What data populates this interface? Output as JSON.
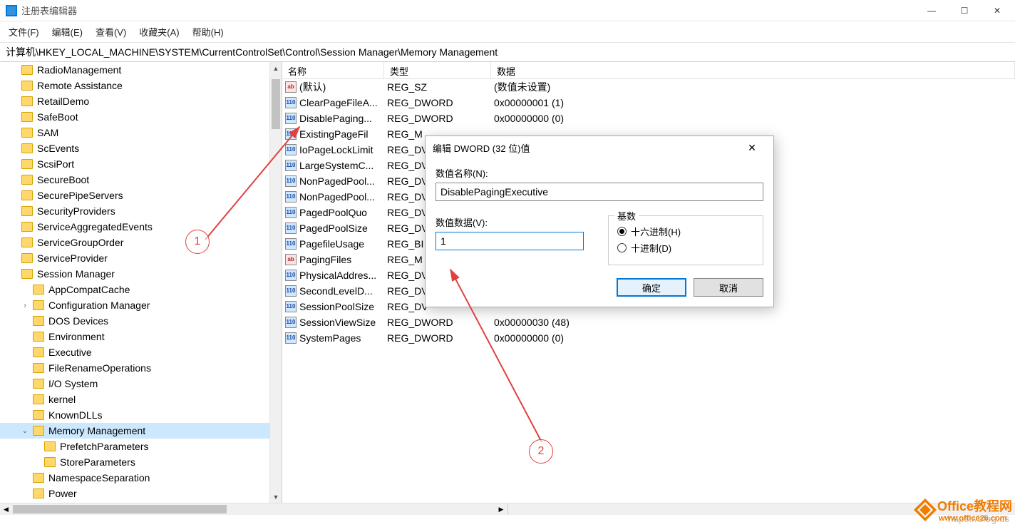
{
  "window": {
    "title": "注册表编辑器"
  },
  "menu": [
    "文件(F)",
    "编辑(E)",
    "查看(V)",
    "收藏夹(A)",
    "帮助(H)"
  ],
  "address": "计算机\\HKEY_LOCAL_MACHINE\\SYSTEM\\CurrentControlSet\\Control\\Session Manager\\Memory Management",
  "tree": [
    {
      "label": "RadioManagement",
      "indent": 0
    },
    {
      "label": "Remote Assistance",
      "indent": 0
    },
    {
      "label": "RetailDemo",
      "indent": 0
    },
    {
      "label": "SafeBoot",
      "indent": 0
    },
    {
      "label": "SAM",
      "indent": 0
    },
    {
      "label": "ScEvents",
      "indent": 0
    },
    {
      "label": "ScsiPort",
      "indent": 0
    },
    {
      "label": "SecureBoot",
      "indent": 0
    },
    {
      "label": "SecurePipeServers",
      "indent": 0
    },
    {
      "label": "SecurityProviders",
      "indent": 0
    },
    {
      "label": "ServiceAggregatedEvents",
      "indent": 0
    },
    {
      "label": "ServiceGroupOrder",
      "indent": 0
    },
    {
      "label": "ServiceProvider",
      "indent": 0
    },
    {
      "label": "Session Manager",
      "indent": 0
    },
    {
      "label": "AppCompatCache",
      "indent": 1
    },
    {
      "label": "Configuration Manager",
      "indent": 1,
      "expander": ">"
    },
    {
      "label": "DOS Devices",
      "indent": 1
    },
    {
      "label": "Environment",
      "indent": 1
    },
    {
      "label": "Executive",
      "indent": 1
    },
    {
      "label": "FileRenameOperations",
      "indent": 1
    },
    {
      "label": "I/O System",
      "indent": 1
    },
    {
      "label": "kernel",
      "indent": 1
    },
    {
      "label": "KnownDLLs",
      "indent": 1
    },
    {
      "label": "Memory Management",
      "indent": 1,
      "expander": "v",
      "selected": true
    },
    {
      "label": "PrefetchParameters",
      "indent": 2
    },
    {
      "label": "StoreParameters",
      "indent": 2
    },
    {
      "label": "NamespaceSeparation",
      "indent": 1
    },
    {
      "label": "Power",
      "indent": 1
    }
  ],
  "list": {
    "headers": {
      "name": "名称",
      "type": "类型",
      "data": "数据"
    },
    "rows": [
      {
        "icon": "sz",
        "name": "(默认)",
        "type": "REG_SZ",
        "data": "(数值未设置)"
      },
      {
        "icon": "dw",
        "name": "ClearPageFileA...",
        "type": "REG_DWORD",
        "data": "0x00000001 (1)"
      },
      {
        "icon": "dw",
        "name": "DisablePaging...",
        "type": "REG_DWORD",
        "data": "0x00000000 (0)"
      },
      {
        "icon": "dw",
        "name": "ExistingPageFil",
        "type": "REG_M"
      },
      {
        "icon": "dw",
        "name": "IoPageLockLimit",
        "type": "REG_DV"
      },
      {
        "icon": "dw",
        "name": "LargeSystemC...",
        "type": "REG_DV"
      },
      {
        "icon": "dw",
        "name": "NonPagedPool...",
        "type": "REG_DV"
      },
      {
        "icon": "dw",
        "name": "NonPagedPool...",
        "type": "REG_DV"
      },
      {
        "icon": "dw",
        "name": "PagedPoolQuo",
        "type": "REG_DV"
      },
      {
        "icon": "dw",
        "name": "PagedPoolSize",
        "type": "REG_DV"
      },
      {
        "icon": "dw",
        "name": "PagefileUsage",
        "type": "REG_BI"
      },
      {
        "icon": "sz",
        "name": "PagingFiles",
        "type": "REG_M"
      },
      {
        "icon": "dw",
        "name": "PhysicalAddres...",
        "type": "REG_DV"
      },
      {
        "icon": "dw",
        "name": "SecondLevelD...",
        "type": "REG_DV"
      },
      {
        "icon": "dw",
        "name": "SessionPoolSize",
        "type": "REG_DV"
      },
      {
        "icon": "dw",
        "name": "SessionViewSize",
        "type": "REG_DWORD",
        "data": "0x00000030 (48)"
      },
      {
        "icon": "dw",
        "name": "SystemPages",
        "type": "REG_DWORD",
        "data": "0x00000000 (0)"
      }
    ]
  },
  "dialog": {
    "title": "编辑 DWORD (32 位)值",
    "name_label": "数值名称(N):",
    "name_value": "DisablePagingExecutive",
    "data_label": "数值数据(V):",
    "data_value": "1",
    "base_label": "基数",
    "radio_hex": "十六进制(H)",
    "radio_dec": "十进制(D)",
    "ok": "确定",
    "cancel": "取消"
  },
  "annotations": {
    "n1": "1",
    "n2": "2"
  },
  "watermark": "https://blog.cs",
  "brand": {
    "line1": "Office教程网",
    "line2": "www.office26.com"
  }
}
